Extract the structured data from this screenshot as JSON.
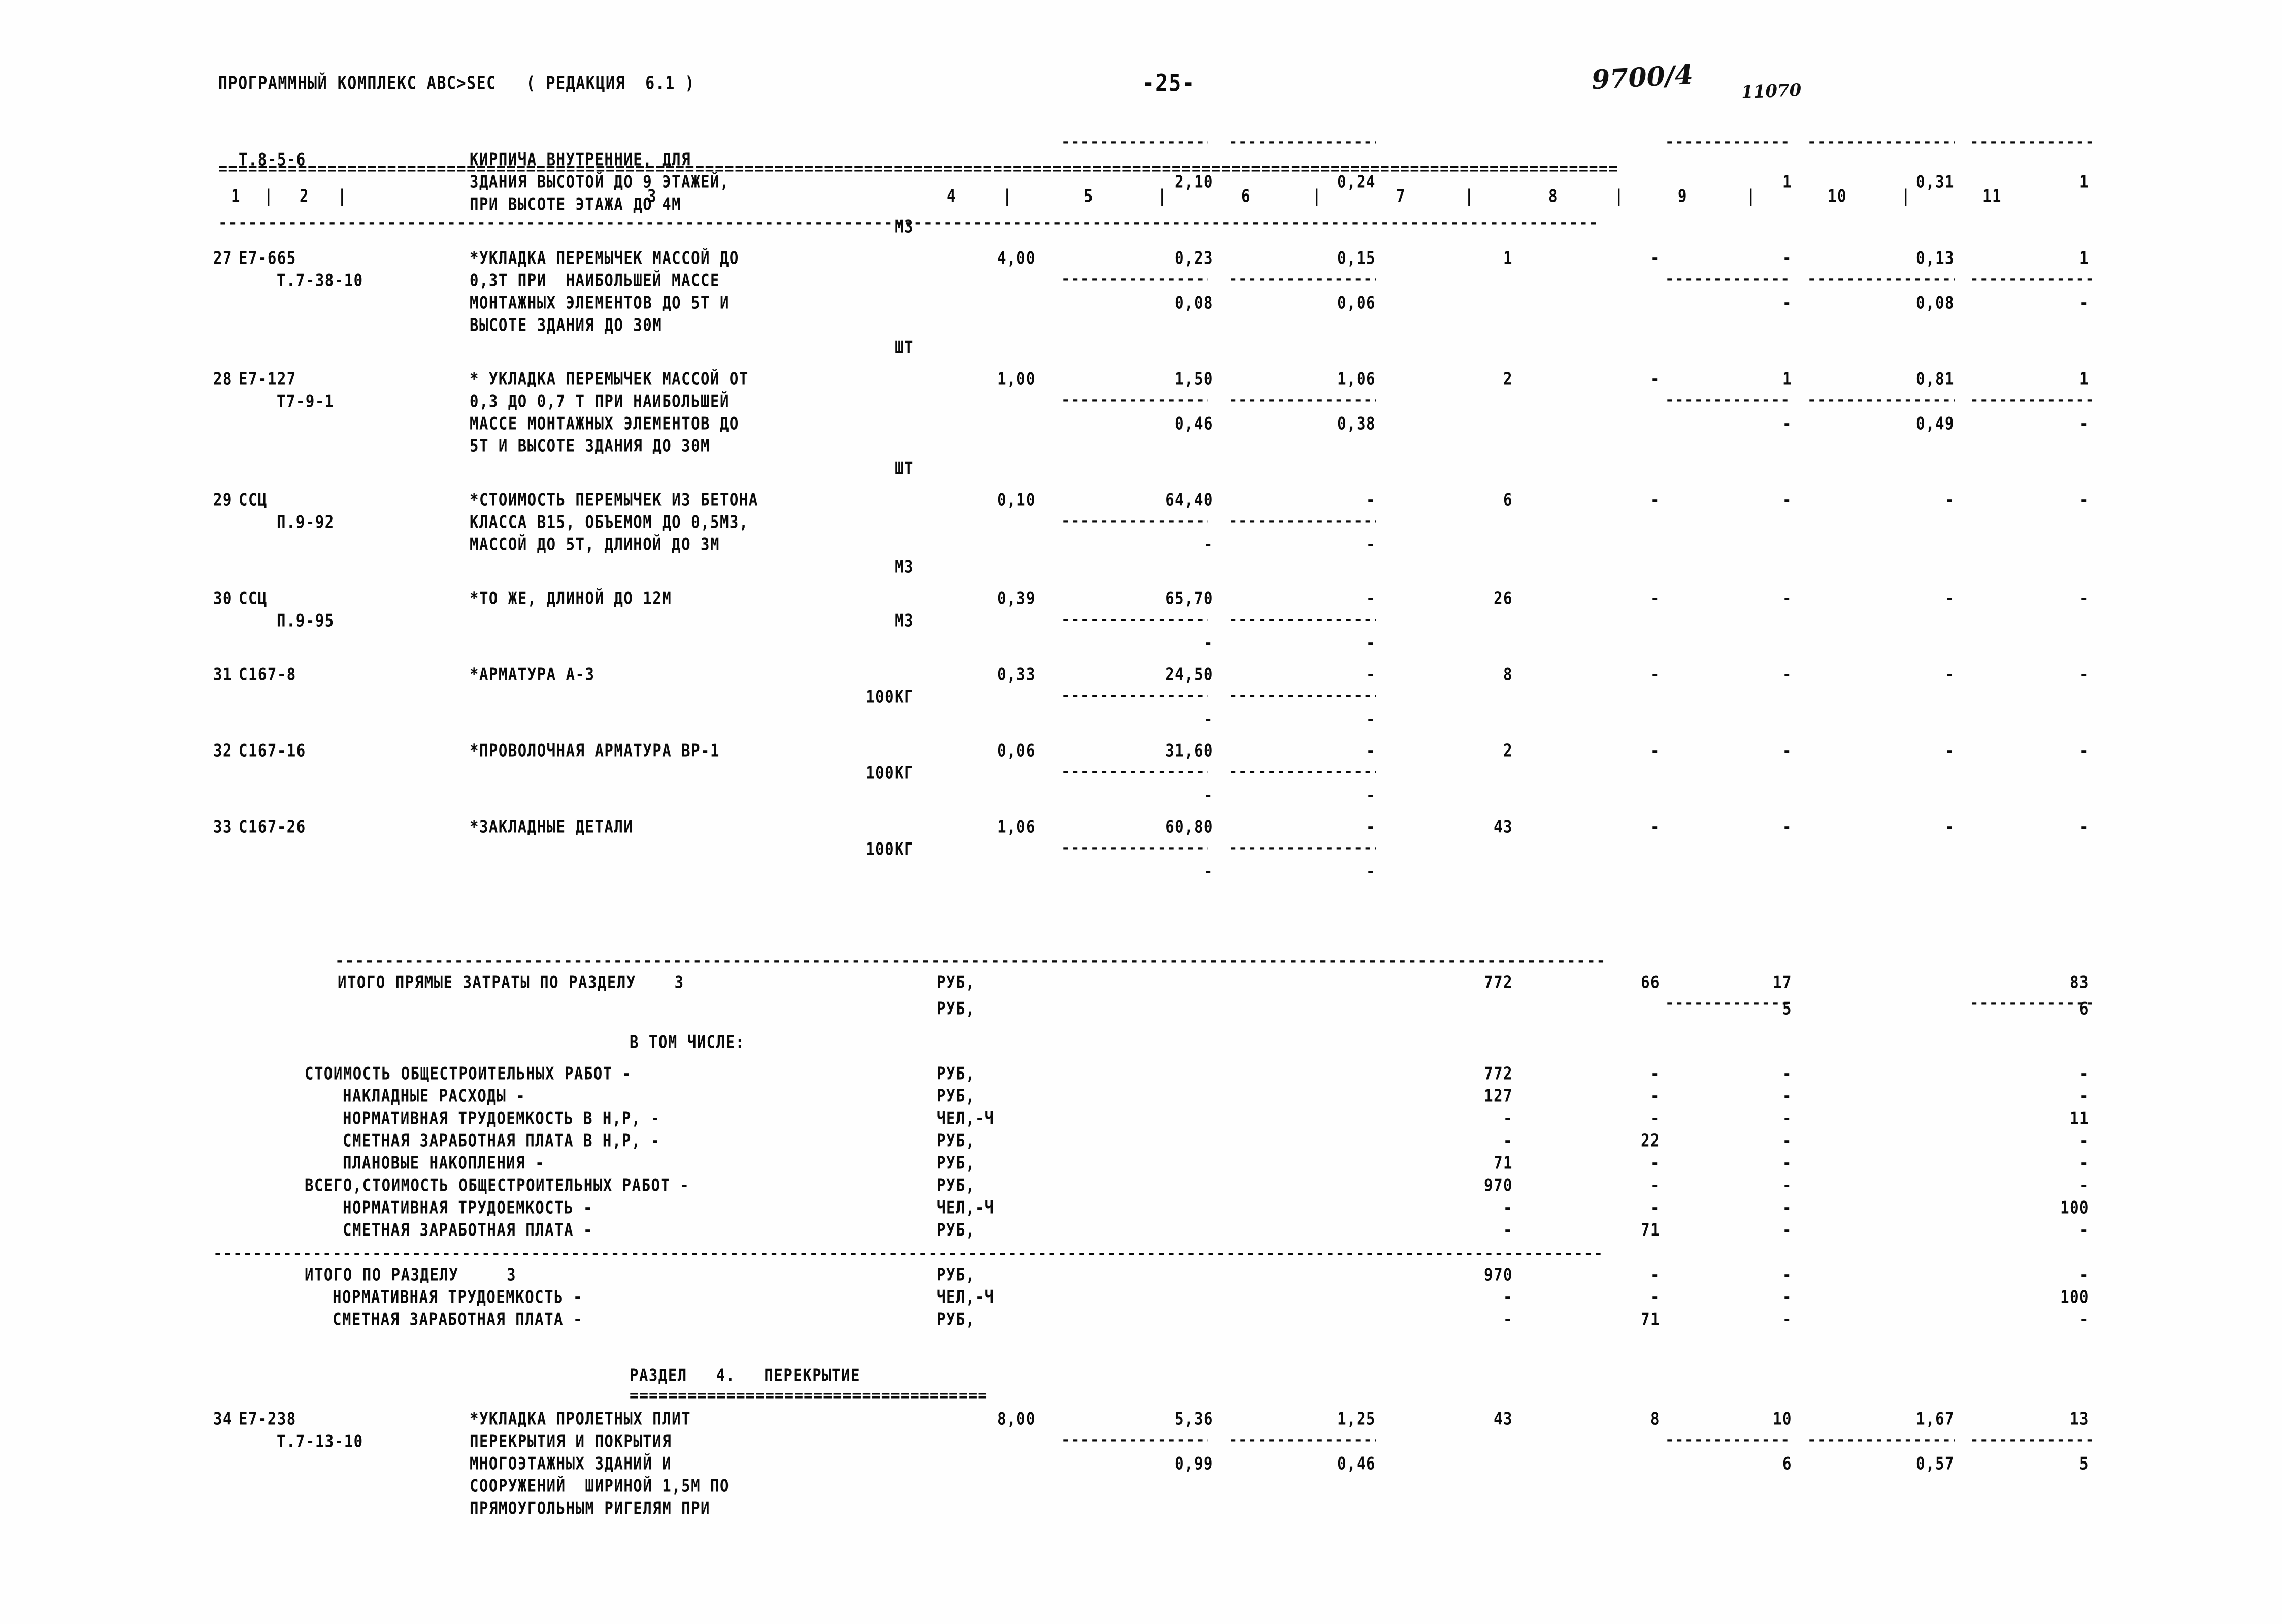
{
  "header": {
    "program_line": "ПРОГРАММНЫЙ КОМПЛЕКС ABC>SEC   ( РЕДАКЦИЯ  6.1 )",
    "page_number": "-25-",
    "stamp_number": "9700/4",
    "stamp_code": "11070"
  },
  "column_headers": [
    "1",
    "2",
    "3",
    "4",
    "5",
    "6",
    "7",
    "8",
    "9",
    "10",
    "11"
  ],
  "rows": [
    {
      "no": "",
      "code1": "Т.8-5-6",
      "code2": "",
      "desc": [
        "КИРПИЧА ВНУТРЕННИЕ, ДЛЯ",
        "ЗДАНИЯ ВЫСОТОЙ ДО 9 ЭТАЖЕЙ,",
        "ПРИ ВЫСОТЕ ЭТАЖА ДО 4М"
      ],
      "unit": "М3",
      "c4": "",
      "c5": "2,10",
      "c6": "0,24",
      "c7": "",
      "c8": "",
      "c9": "1",
      "c10": "0,31",
      "c11": "1",
      "sub": null
    },
    {
      "no": "27",
      "code1": "Е7-665",
      "code2": "Т.7-38-10",
      "desc": [
        "*УКЛАДКА ПЕРЕМЫЧЕК МАССОЙ ДО",
        "0,3Т ПРИ  НАИБОЛЬШЕЙ МАССЕ",
        "МОНТАЖНЫХ ЭЛЕМЕНТОВ ДО 5Т И",
        "ВЫСОТЕ ЗДАНИЯ ДО 30М"
      ],
      "unit": "ШТ",
      "c4": "4,00",
      "c5": "0,23",
      "c6": "0,15",
      "c7": "1",
      "c8": "-",
      "c9": "-",
      "c10": "0,13",
      "c11": "1",
      "sub": {
        "c5": "0,08",
        "c6": "0,06",
        "c9": "-",
        "c10": "0,08",
        "c11": "-"
      }
    },
    {
      "no": "28",
      "code1": "Е7-127",
      "code2": "Т7-9-1",
      "desc": [
        "* УКЛАДКА ПЕРЕМЫЧЕК МАССОЙ ОТ",
        "0,3 ДО 0,7 Т ПРИ НАИБОЛЬШЕЙ",
        "МАССЕ МОНТАЖНЫХ ЭЛЕМЕНТОВ ДО",
        "5Т И ВЫСОТЕ ЗДАНИЯ ДО 30М"
      ],
      "unit": "ШТ",
      "c4": "1,00",
      "c5": "1,50",
      "c6": "1,06",
      "c7": "2",
      "c8": "-",
      "c9": "1",
      "c10": "0,81",
      "c11": "1",
      "sub": {
        "c5": "0,46",
        "c6": "0,38",
        "c9": "-",
        "c10": "0,49",
        "c11": "-"
      }
    },
    {
      "no": "29",
      "code1": "ССЦ",
      "code2": "П.9-92",
      "desc": [
        "*СТОИМОСТЬ ПЕРЕМЫЧЕК ИЗ БЕТОНА",
        "КЛАССА В15, ОБЪЕМОМ ДО 0,5М3,",
        "МАССОЙ ДО 5Т, ДЛИНОЙ ДО 3М"
      ],
      "unit": "М3",
      "c4": "0,10",
      "c5": "64,40",
      "c6": "-",
      "c7": "6",
      "c8": "-",
      "c9": "-",
      "c10": "-",
      "c11": "-",
      "sub": {
        "c5": "-",
        "c6": "-",
        "c9": "",
        "c10": "",
        "c11": ""
      }
    },
    {
      "no": "30",
      "code1": "ССЦ",
      "code2": "П.9-95",
      "desc": [
        "*ТО ЖЕ, ДЛИНОЙ ДО 12М"
      ],
      "unit": "М3",
      "c4": "0,39",
      "c5": "65,70",
      "c6": "-",
      "c7": "26",
      "c8": "-",
      "c9": "-",
      "c10": "-",
      "c11": "-",
      "sub": {
        "c5": "-",
        "c6": "-",
        "c9": "",
        "c10": "",
        "c11": ""
      }
    },
    {
      "no": "31",
      "code1": "С167-8",
      "code2": "",
      "desc": [
        "*АРМАТУРА А-3"
      ],
      "unit": "100КГ",
      "c4": "0,33",
      "c5": "24,50",
      "c6": "-",
      "c7": "8",
      "c8": "-",
      "c9": "-",
      "c10": "-",
      "c11": "-",
      "sub": {
        "c5": "-",
        "c6": "-",
        "c9": "",
        "c10": "",
        "c11": ""
      }
    },
    {
      "no": "32",
      "code1": "С167-16",
      "code2": "",
      "desc": [
        "*ПРОВОЛОЧНАЯ АРМАТУРА ВР-1"
      ],
      "unit": "100КГ",
      "c4": "0,06",
      "c5": "31,60",
      "c6": "-",
      "c7": "2",
      "c8": "-",
      "c9": "-",
      "c10": "-",
      "c11": "-",
      "sub": {
        "c5": "-",
        "c6": "-",
        "c9": "",
        "c10": "",
        "c11": ""
      }
    },
    {
      "no": "33",
      "code1": "С167-26",
      "code2": "",
      "desc": [
        "*ЗАКЛАДНЫЕ ДЕТАЛИ"
      ],
      "unit": "100КГ",
      "c4": "1,06",
      "c5": "60,80",
      "c6": "-",
      "c7": "43",
      "c8": "-",
      "c9": "-",
      "c10": "-",
      "c11": "-",
      "sub": {
        "c5": "-",
        "c6": "-",
        "c9": "",
        "c10": "",
        "c11": ""
      }
    }
  ],
  "totals": {
    "itogo_label": "ИТОГО ПРЯМЫЕ ЗАТРАТЫ ПО РАЗДЕЛУ    3",
    "itogo_unit": "РУБ,",
    "itogo": {
      "c7": "772",
      "c8": "66",
      "c9": "17",
      "c11": "83"
    },
    "itogo_unit2": "РУБ,",
    "itogo2": {
      "c9": "5",
      "c11": "6"
    },
    "v_tom_chisle": "В ТОМ ЧИСЛЕ:",
    "lines": [
      {
        "label": "СТОИМОСТЬ ОБЩЕСТРОИТЕЛЬНЫХ РАБОТ -",
        "indent": 0,
        "unit": "РУБ,",
        "c7": "772",
        "c8": "-",
        "c9": "-",
        "c11": "-"
      },
      {
        "label": "НАКЛАДНЫЕ РАСХОДЫ -",
        "indent": 1,
        "unit": "РУБ,",
        "c7": "127",
        "c8": "-",
        "c9": "-",
        "c11": "-"
      },
      {
        "label": "НОРМАТИВНАЯ ТРУДОЕМКОСТЬ В Н,Р, -",
        "indent": 1,
        "unit": "ЧЕЛ,-Ч",
        "c7": "-",
        "c8": "-",
        "c9": "-",
        "c11": "11"
      },
      {
        "label": "СМЕТНАЯ ЗАРАБОТНАЯ ПЛАТА В Н,Р, -",
        "indent": 1,
        "unit": "РУБ,",
        "c7": "-",
        "c8": "22",
        "c9": "-",
        "c11": "-"
      },
      {
        "label": "ПЛАНОВЫЕ НАКОПЛЕНИЯ -",
        "indent": 1,
        "unit": "РУБ,",
        "c7": "71",
        "c8": "-",
        "c9": "-",
        "c11": "-"
      },
      {
        "label": "ВСЕГО,СТОИМОСТЬ ОБЩЕСТРОИТЕЛЬНЫХ РАБОТ -",
        "indent": 0,
        "unit": "РУБ,",
        "c7": "970",
        "c8": "-",
        "c9": "-",
        "c11": "-"
      },
      {
        "label": "НОРМАТИВНАЯ ТРУДОЕМКОСТЬ -",
        "indent": 1,
        "unit": "ЧЕЛ,-Ч",
        "c7": "-",
        "c8": "-",
        "c9": "-",
        "c11": "100"
      },
      {
        "label": "СМЕТНАЯ ЗАРАБОТНАЯ ПЛАТА -",
        "indent": 1,
        "unit": "РУБ,",
        "c7": "-",
        "c8": "71",
        "c9": "-",
        "c11": "-"
      }
    ],
    "razdel_lines": [
      {
        "label": "ИТОГО ПО РАЗДЕЛУ     3",
        "unit": "РУБ,",
        "c7": "970",
        "c8": "-",
        "c9": "-",
        "c11": "-"
      },
      {
        "label": "НОРМАТИВНАЯ ТРУДОЕМКОСТЬ -",
        "unit": "ЧЕЛ,-Ч",
        "c7": "-",
        "c8": "-",
        "c9": "-",
        "c11": "100"
      },
      {
        "label": "СМЕТНАЯ ЗАРАБОТНАЯ ПЛАТА -",
        "unit": "РУБ,",
        "c7": "-",
        "c8": "71",
        "c9": "-",
        "c11": "-"
      }
    ]
  },
  "section4": {
    "title": "РАЗДЕЛ   4.   ПЕРЕКРЫТИЕ",
    "row": {
      "no": "34",
      "code1": "Е7-238",
      "code2": "Т.7-13-10",
      "desc": [
        "*УКЛАДКА ПРОЛЕТНЫХ ПЛИТ",
        "ПЕРЕКРЫТИЯ И ПОКРЫТИЯ",
        "МНОГОЭТАЖНЫХ ЗДАНИЙ И",
        "СООРУЖЕНИЙ  ШИРИНОЙ 1,5М ПО",
        "ПРЯМОУГОЛЬНЫМ РИГЕЛЯМ ПРИ"
      ],
      "c4": "8,00",
      "c5": "5,36",
      "c6": "1,25",
      "c7": "43",
      "c8": "8",
      "c9": "10",
      "c10": "1,67",
      "c11": "13",
      "sub": {
        "c5": "0,99",
        "c6": "0,46",
        "c9": "6",
        "c10": "0,57",
        "c11": "5"
      }
    }
  }
}
